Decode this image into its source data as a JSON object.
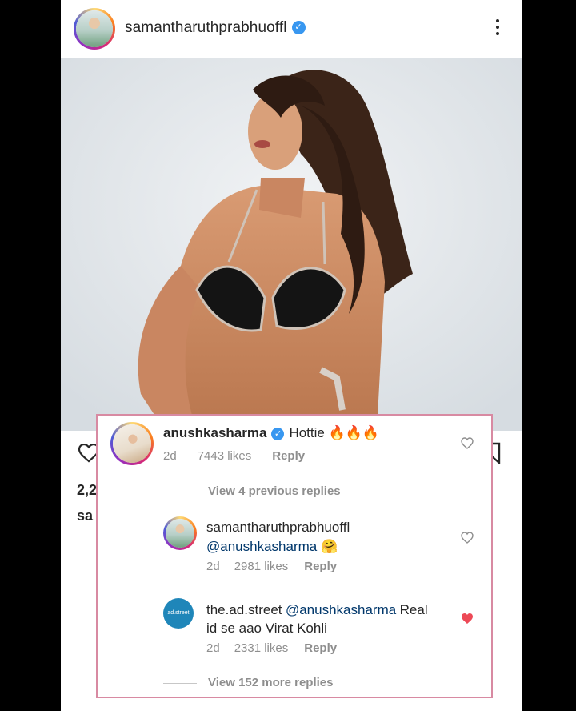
{
  "header": {
    "username": "samantharuthprabhuoffl",
    "verified_icon": "verified-badge-icon",
    "more_icon": "more-options-icon"
  },
  "post": {
    "likes_partial": "2,2",
    "caption_partial": "sa"
  },
  "comments": [
    {
      "username": "anushkasharma",
      "verified": true,
      "text": "Hottie 🔥🔥🔥",
      "time": "2d",
      "likes": "7443 likes",
      "reply": "Reply",
      "liked": false
    }
  ],
  "view_previous": "View 4 previous replies",
  "replies": [
    {
      "username": "samantharuthprabhuoffl",
      "mention": "@anushkasharma",
      "text": "🤗",
      "time": "2d",
      "likes": "2981 likes",
      "reply": "Reply",
      "liked": false
    },
    {
      "username": "the.ad.street",
      "mention": "@anushkasharma",
      "text_line1": "Real",
      "text_line2": "id se aao Virat Kohli",
      "time": "2d",
      "likes": "2331 likes",
      "reply": "Reply",
      "liked": true
    }
  ],
  "view_more": "View 152 more replies",
  "colors": {
    "verified": "#3897f0",
    "liked_heart": "#ed4956",
    "highlight_border": "#d88aa2"
  }
}
